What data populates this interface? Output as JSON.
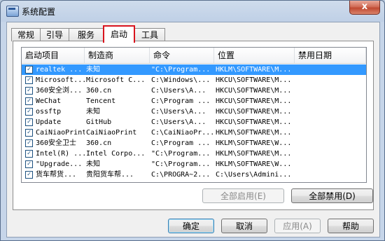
{
  "window": {
    "title": "系统配置",
    "close_label": "x"
  },
  "tabs": [
    {
      "label": "常规"
    },
    {
      "label": "引导"
    },
    {
      "label": "服务"
    },
    {
      "label": "启动"
    },
    {
      "label": "工具"
    }
  ],
  "columns": [
    "启动项目",
    "制造商",
    "命令",
    "位置",
    "禁用日期"
  ],
  "rows": [
    {
      "item": "realtek ...",
      "maker": "未知",
      "command": "\"C:\\Program...",
      "location": "HKLM\\SOFTWARE\\M..."
    },
    {
      "item": "Microsoft...",
      "maker": "Microsoft C...",
      "command": "C:\\Windows\\...",
      "location": "HKCU\\SOFTWARE\\M..."
    },
    {
      "item": "360安全浏...",
      "maker": "360.cn",
      "command": "C:\\Users\\A...",
      "location": "HKCU\\SOFTWARE\\M..."
    },
    {
      "item": "WeChat",
      "maker": "Tencent",
      "command": "C:\\Program ...",
      "location": "HKCU\\SOFTWARE\\M..."
    },
    {
      "item": "ossftp",
      "maker": "未知",
      "command": "C:\\Users\\A...",
      "location": "HKCU\\SOFTWARE\\M..."
    },
    {
      "item": "Update",
      "maker": "GitHub",
      "command": "C:\\Users\\A...",
      "location": "HKCU\\SOFTWARE\\M..."
    },
    {
      "item": "CaiNiaoPrint",
      "maker": "CaiNiaoPrint",
      "command": "C:\\CaiNiaoPr...",
      "location": "HKLM\\SOFTWARE\\M..."
    },
    {
      "item": "360安全卫士",
      "maker": "360.cn",
      "command": "C:\\Program ...",
      "location": "HKLM\\SOFTWARE\\W..."
    },
    {
      "item": "Intel(R) ...",
      "maker": "Intel Corpo...",
      "command": "\"C:\\Program...",
      "location": "HKLM\\SOFTWARE\\M..."
    },
    {
      "item": "\"Upgrade...",
      "maker": "未知",
      "command": "\"C:\\Program...",
      "location": "HKLM\\SOFTWARE\\W..."
    },
    {
      "item": "货车帮货...",
      "maker": "贵阳货车帮...",
      "command": "C:\\PROGRA~2...",
      "location": "C:\\Users\\Admini..."
    }
  ],
  "buttons": {
    "enable_all": "全部启用(E)",
    "disable_all": "全部禁用(D)",
    "ok": "确定",
    "cancel": "取消",
    "apply": "应用(A)",
    "help": "帮助"
  }
}
